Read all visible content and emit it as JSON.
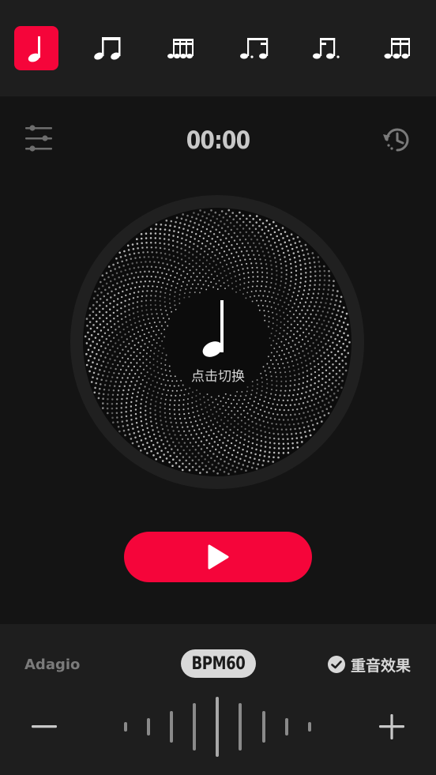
{
  "note_tabs": [
    {
      "name": "quarter-note-icon",
      "active": true
    },
    {
      "name": "eighth-notes-icon",
      "active": false
    },
    {
      "name": "sixteenth-notes-icon",
      "active": false
    },
    {
      "name": "dotted-eighth-sixteenth-icon",
      "active": false
    },
    {
      "name": "sixteenth-dotted-eighth-icon",
      "active": false
    },
    {
      "name": "triplet-notes-icon",
      "active": false
    }
  ],
  "timer": "00:00",
  "dial": {
    "tap_label": "点击切换",
    "note_icon": "quarter-note-icon"
  },
  "controls": {
    "tempo_name": "Adagio",
    "bpm_label": "BPM60",
    "accent_label": "重音效果",
    "accent_checked": true
  },
  "colors": {
    "accent": "#f5053a",
    "background": "#141414",
    "panel": "#1e1e1e"
  }
}
